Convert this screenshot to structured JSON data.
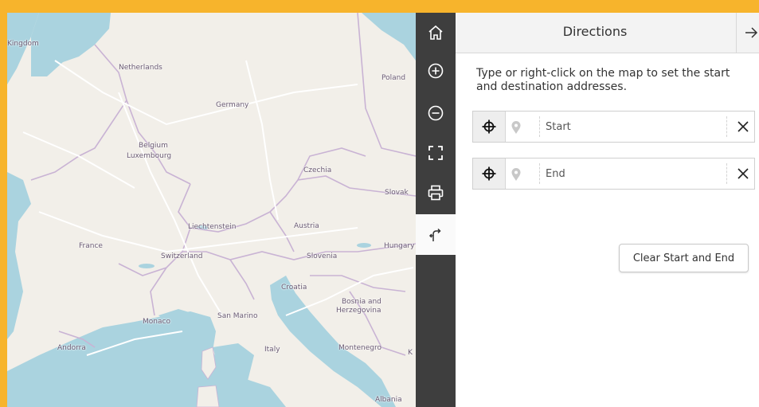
{
  "map": {
    "labels": {
      "united_kingdom": "Kingdom",
      "netherlands": "Netherlands",
      "germany": "Germany",
      "poland": "Poland",
      "belgium": "Belgium",
      "luxembourg": "Luxembourg",
      "czechia": "Czechia",
      "slovakia": "Slovak",
      "france": "France",
      "liechtenstein": "Liechtenstein",
      "austria": "Austria",
      "switzerland": "Switzerland",
      "slovenia": "Slovenia",
      "hungary": "Hungary",
      "croatia": "Croatia",
      "bosnia": "Bosnia and",
      "herzegovina": "Herzegovina",
      "monaco": "Monaco",
      "san_marino": "San Marino",
      "andorra": "Andorra",
      "italy": "Italy",
      "montenegro": "Montenegro",
      "kosovo": "K",
      "albania": "Albania"
    },
    "colors": {
      "land": "#f2efe9",
      "water": "#aad3df",
      "border": "#c9b3d4",
      "road": "#ffffff"
    }
  },
  "toolbar": {
    "tools": [
      {
        "name": "home",
        "icon": "home-icon"
      },
      {
        "name": "zoom-in",
        "icon": "plus-circle-icon"
      },
      {
        "name": "zoom-out",
        "icon": "minus-circle-icon"
      },
      {
        "name": "full-screen",
        "icon": "expand-icon"
      },
      {
        "name": "print",
        "icon": "printer-icon"
      },
      {
        "name": "directions",
        "icon": "directions-icon",
        "active": true
      }
    ]
  },
  "panel": {
    "title": "Directions",
    "instructions": "Type or right-click on the map to set the start and destination addresses.",
    "start": {
      "value": "",
      "placeholder": "Start"
    },
    "end": {
      "value": "",
      "placeholder": "End"
    },
    "clear_label": "Clear Start and End"
  },
  "colors": {
    "frame": "#f7b42c",
    "toolbar": "#3e3e3e"
  }
}
